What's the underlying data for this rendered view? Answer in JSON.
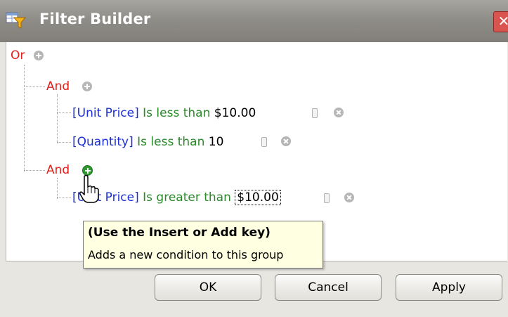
{
  "window": {
    "title": "Filter Builder",
    "close_glyph": "✕"
  },
  "tree": {
    "root": {
      "operator": "Or"
    },
    "groups": [
      {
        "operator": "And",
        "conditions": [
          {
            "field": "[Unit Price]",
            "operator": "Is less than",
            "value": "$10.00"
          },
          {
            "field": "[Quantity]",
            "operator": "Is less than",
            "value": "10"
          }
        ]
      },
      {
        "operator": "And",
        "conditions": [
          {
            "field": "[Unit Price]",
            "operator": "Is greater than",
            "value": "$10.00"
          }
        ]
      }
    ]
  },
  "tooltip": {
    "title": "(Use the Insert or Add key)",
    "text": "Adds a new condition to this group"
  },
  "buttons": {
    "ok": "OK",
    "cancel": "Cancel",
    "apply": "Apply"
  },
  "colors": {
    "group_operator": "#e0201b",
    "field": "#1a2fd6",
    "condition_operator": "#2a8a2a",
    "tooltip_bg": "#ffffe1"
  },
  "icons": {
    "window": "filter-funnel-icon",
    "add": "add-circle-icon",
    "remove": "remove-circle-icon",
    "cursor": "hand-pointer-icon"
  }
}
